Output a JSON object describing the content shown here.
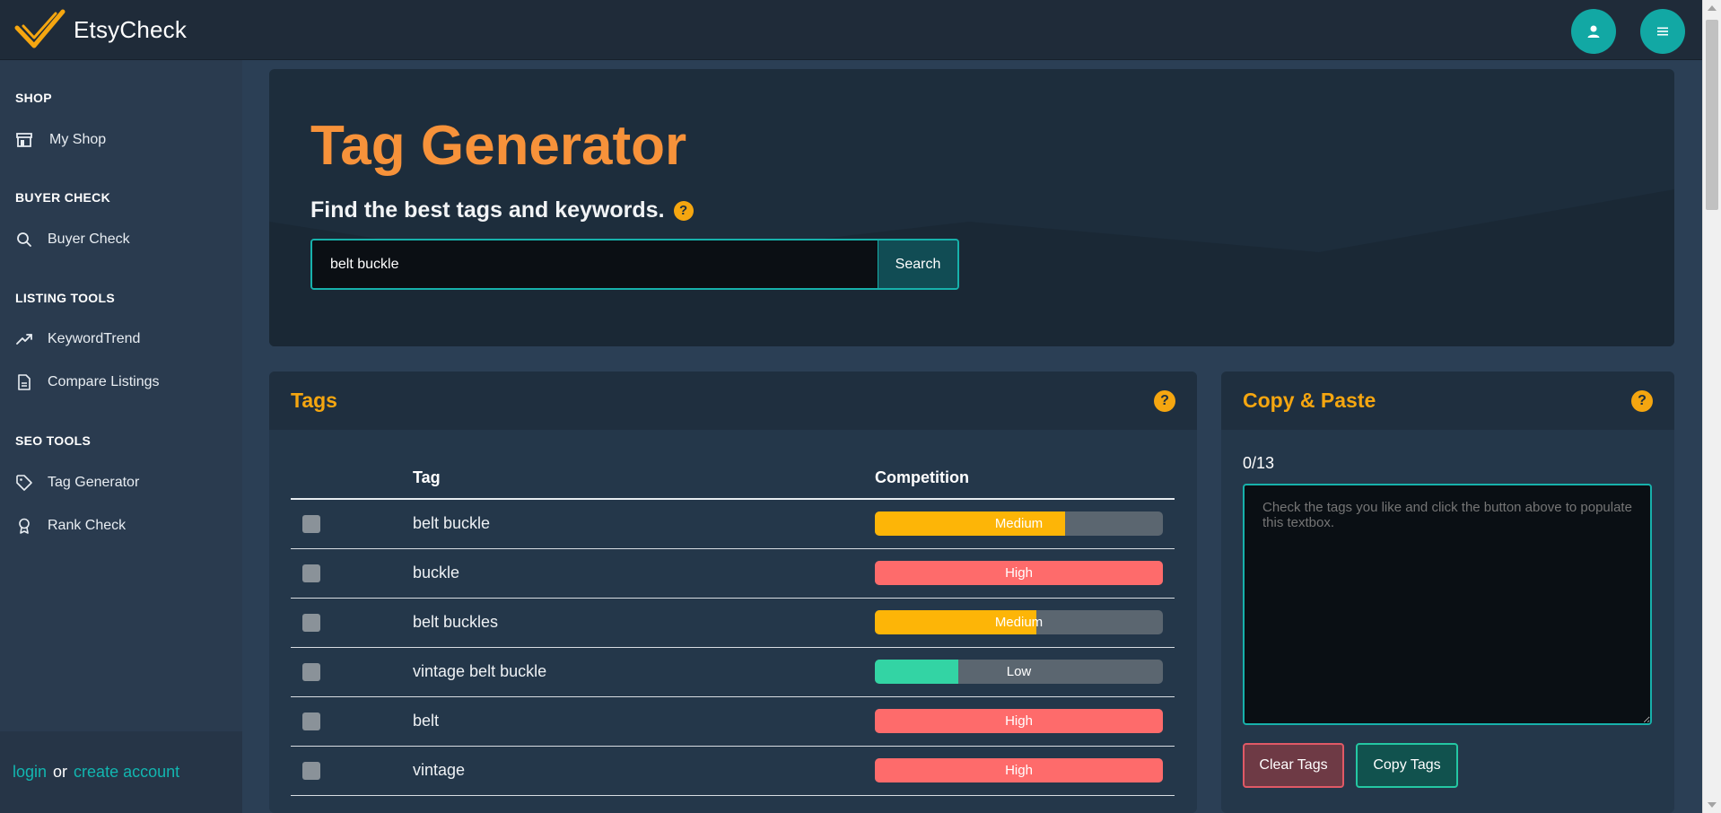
{
  "app": {
    "name": "EtsyCheck"
  },
  "sidebar": {
    "sections": [
      {
        "title": "SHOP",
        "items": [
          {
            "label": "My Shop",
            "icon": "store-icon"
          }
        ]
      },
      {
        "title": "BUYER CHECK",
        "items": [
          {
            "label": "Buyer Check",
            "icon": "search-icon"
          }
        ]
      },
      {
        "title": "LISTING TOOLS",
        "items": [
          {
            "label": "KeywordTrend",
            "icon": "trend-icon"
          },
          {
            "label": "Compare Listings",
            "icon": "document-icon"
          }
        ]
      },
      {
        "title": "SEO TOOLS",
        "items": [
          {
            "label": "Tag Generator",
            "icon": "tag-icon"
          },
          {
            "label": "Rank Check",
            "icon": "award-icon"
          }
        ]
      }
    ],
    "footer": {
      "login": "login",
      "or": "or",
      "create": "create account"
    }
  },
  "hero": {
    "title": "Tag Generator",
    "subtitle": "Find the best tags and keywords.",
    "search_value": "belt buckle",
    "search_button": "Search"
  },
  "tags": {
    "title": "Tags",
    "columns": {
      "tag": "Tag",
      "competition": "Competition"
    },
    "rows": [
      {
        "tag": "belt buckle",
        "competition": "Medium",
        "level": 0.66
      },
      {
        "tag": "buckle",
        "competition": "High",
        "level": 1.0
      },
      {
        "tag": "belt buckles",
        "competition": "Medium",
        "level": 0.56
      },
      {
        "tag": "vintage belt buckle",
        "competition": "Low",
        "level": 0.29
      },
      {
        "tag": "belt",
        "competition": "High",
        "level": 1.0
      },
      {
        "tag": "vintage",
        "competition": "High",
        "level": 1.0
      }
    ]
  },
  "copy": {
    "title": "Copy & Paste",
    "counter": "0/13",
    "placeholder": "Check the tags you like and click the button above to populate this textbox.",
    "clear_button": "Clear Tags",
    "copy_button": "Copy Tags"
  },
  "colors": {
    "accent": "#12a8a4",
    "orange": "#f7923a",
    "high": "#fe6b6b",
    "medium": "#fdb507",
    "low": "#33d4a4"
  }
}
